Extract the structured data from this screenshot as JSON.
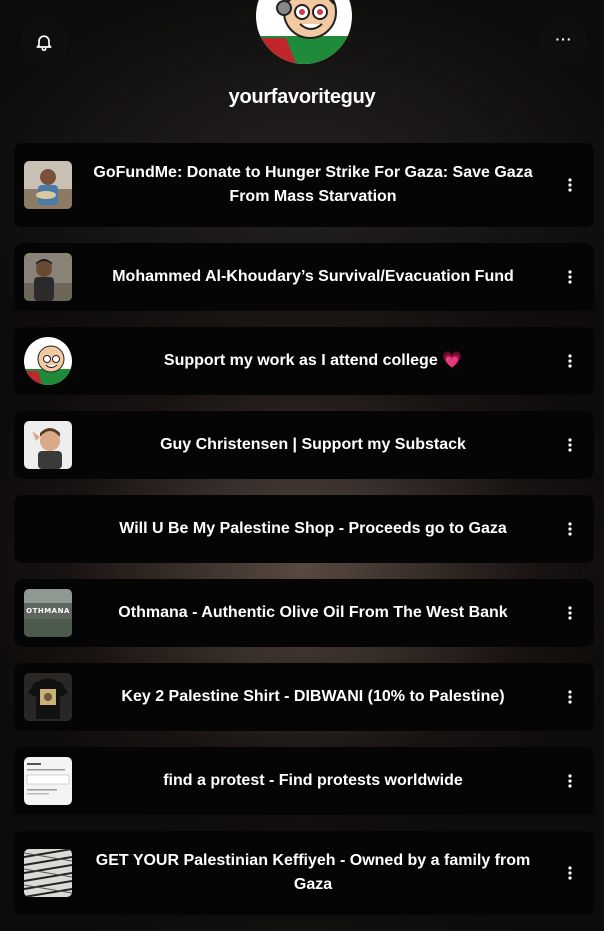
{
  "profile": {
    "username": "yourfavoriteguy",
    "avatar_icon": "cartoon-avatar-palestine-flag"
  },
  "header": {
    "bell_icon": "bell-icon",
    "more_label": "···"
  },
  "colors": {
    "card_background": "#050505",
    "page_background": "#0d0b0b",
    "text": "#ffffff",
    "heart": "#e8708c"
  },
  "links": [
    {
      "title": "GoFundMe: Donate to Hunger Strike For Gaza: Save Gaza From Mass Starvation",
      "thumbnail": "child-photo"
    },
    {
      "title": "Mohammed Al-Khoudary’s Survival/Evacuation Fund",
      "thumbnail": "man-photo"
    },
    {
      "title": "Support my work as I attend college 💗",
      "thumbnail": "cartoon-avatar"
    },
    {
      "title": "Guy Christensen | Support my Substack",
      "thumbnail": "person-photo"
    },
    {
      "title": "Will U Be My Palestine Shop - Proceeds go to Gaza",
      "thumbnail": "none"
    },
    {
      "title": "Othmana - Authentic Olive Oil From The West Bank",
      "thumbnail": "othmana-sign-photo",
      "thumbnail_text": "OTHMANA"
    },
    {
      "title": "Key 2 Palestine Shirt - DIBWANI (10% to Palestine)",
      "thumbnail": "shirt-photo"
    },
    {
      "title": "find a protest - Find protests worldwide",
      "thumbnail": "website-screenshot"
    },
    {
      "title": "GET YOUR Palestinian Keffiyeh - Owned by a family from Gaza",
      "thumbnail": "keffiyeh-photo"
    }
  ]
}
